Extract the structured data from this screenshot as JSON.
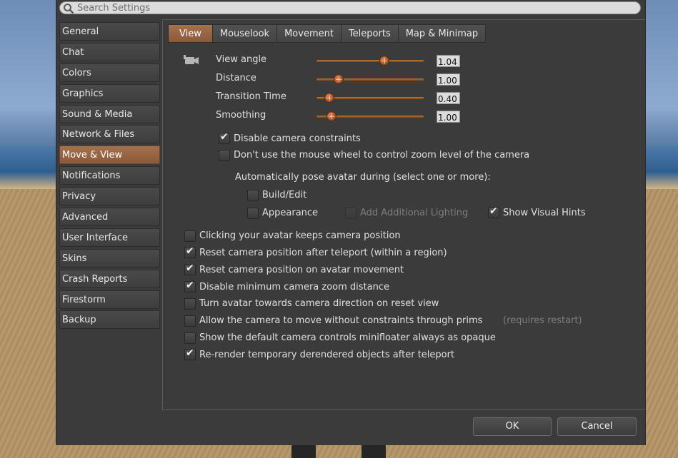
{
  "search": {
    "placeholder": "Search Settings"
  },
  "sidebar": {
    "items": [
      {
        "label": "General"
      },
      {
        "label": "Chat"
      },
      {
        "label": "Colors"
      },
      {
        "label": "Graphics"
      },
      {
        "label": "Sound & Media"
      },
      {
        "label": "Network & Files"
      },
      {
        "label": "Move & View"
      },
      {
        "label": "Notifications"
      },
      {
        "label": "Privacy"
      },
      {
        "label": "Advanced"
      },
      {
        "label": "User Interface"
      },
      {
        "label": "Skins"
      },
      {
        "label": "Crash Reports"
      },
      {
        "label": "Firestorm"
      },
      {
        "label": "Backup"
      }
    ],
    "active": "Move & View"
  },
  "tabs": [
    {
      "label": "View"
    },
    {
      "label": "Mouselook"
    },
    {
      "label": "Movement"
    },
    {
      "label": "Teleports"
    },
    {
      "label": "Map & Minimap"
    }
  ],
  "active_tab": "View",
  "camera": {
    "icon": "camera-icon",
    "sliders": [
      {
        "label": "View angle",
        "value": "1.04",
        "fraction": 0.65
      },
      {
        "label": "Distance",
        "value": "1.00",
        "fraction": 0.18
      },
      {
        "label": "Transition Time",
        "value": "0.40",
        "fraction": 0.08
      },
      {
        "label": "Smoothing",
        "value": "1.00",
        "fraction": 0.1
      }
    ]
  },
  "options": {
    "disable_constraints": {
      "label": "Disable camera constraints",
      "checked": true
    },
    "no_mouse_wheel": {
      "label": "Don't use the mouse wheel to control zoom level of the camera",
      "checked": false
    },
    "autopose_header": "Automatically pose avatar during (select one or more):",
    "build_edit": {
      "label": "Build/Edit",
      "checked": false
    },
    "appearance": {
      "label": "Appearance",
      "checked": false
    },
    "add_lighting": {
      "label": "Add Additional Lighting",
      "checked": false,
      "enabled": false
    },
    "visual_hints": {
      "label": "Show Visual Hints",
      "checked": true
    },
    "list": [
      {
        "label": "Clicking your avatar keeps camera position",
        "checked": false
      },
      {
        "label": "Reset camera position after teleport (within a region)",
        "checked": true
      },
      {
        "label": "Reset camera position on avatar movement",
        "checked": true
      },
      {
        "label": "Disable minimum camera zoom distance",
        "checked": true
      },
      {
        "label": "Turn avatar towards camera direction on reset view",
        "checked": false
      },
      {
        "label": "Allow the camera to move without constraints through prims",
        "checked": false
      },
      {
        "label": "Show the default camera controls minifloater always as opaque",
        "checked": false
      },
      {
        "label": "Re-render temporary derendered objects after teleport",
        "checked": true
      }
    ],
    "requires_restart": "(requires restart)"
  },
  "buttons": {
    "ok": "OK",
    "cancel": "Cancel"
  },
  "colors": {
    "accent": "#9a6544",
    "panel": "#3b3b3b",
    "slider": "#b06c28"
  }
}
